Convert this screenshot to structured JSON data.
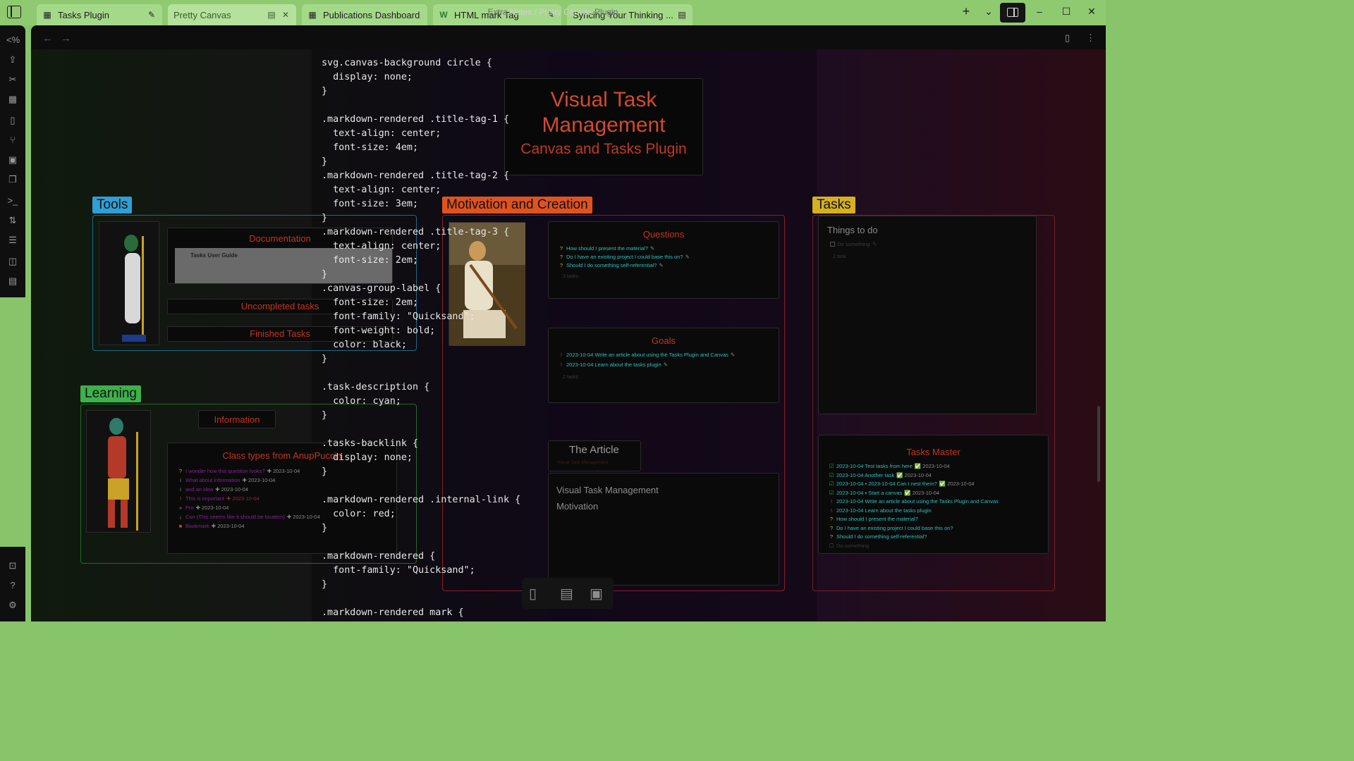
{
  "tabs": [
    {
      "label": "Tasks Plugin",
      "icon": "grid-icon",
      "right": "pin-icon"
    },
    {
      "label": "Pretty Canvas",
      "icon": "",
      "right": "close-icon"
    },
    {
      "label": "Publications Dashboard",
      "icon": "grid-icon",
      "right": ""
    },
    {
      "label": "HTML mark Tag",
      "icon": "w-icon",
      "right": "pin-icon"
    },
    {
      "label": "Syncing Your Thinking ...",
      "icon": "",
      "right": "clipboard-icon"
    }
  ],
  "breadcrumb": {
    "faded": "Extra",
    "path": "Notes / Pretty Canvas",
    "faded_right": "Plugin"
  },
  "code_lines": [
    "svg.canvas-background circle {",
    "  display: none;",
    "}",
    "",
    ".markdown-rendered .title-tag-1 {",
    "  text-align: center;",
    "  font-size: 4em;",
    "}",
    ".markdown-rendered .title-tag-2 {",
    "  text-align: center;",
    "  font-size: 3em;",
    "}",
    ".markdown-rendered .title-tag-3 {",
    "  text-align: center;",
    "  font-size: 2em;",
    "}",
    ".canvas-group-label {",
    "  font-size: 2em;",
    "  font-family: \"Quicksand\";",
    "  font-weight: bold;",
    "  color: black;",
    "}",
    "",
    ".task-description {",
    "  color: cyan;",
    "}",
    "",
    ".tasks-backlink {",
    "  display: none;",
    "}",
    "",
    ".markdown-rendered .internal-link {",
    "  color: red;",
    "}",
    "",
    ".markdown-rendered {",
    "  font-family: \"Quicksand\";",
    "}",
    "",
    ".markdown-rendered mark {"
  ],
  "title_card": {
    "line1": "Visual Task",
    "line2": "Management",
    "subtitle": "Canvas and Tasks Plugin"
  },
  "groups": {
    "tools": {
      "label": "Tools",
      "color": "#2fa0d6"
    },
    "learning": {
      "label": "Learning",
      "color": "#3bb24a"
    },
    "motivation": {
      "label": "Motivation and Creation",
      "color": "#e0531e"
    },
    "tasks": {
      "label": "Tasks",
      "color": "#d6b01e"
    }
  },
  "tools": {
    "documentation": "Documentation",
    "embed_title": "Tasks User Guide",
    "uncompleted": "Uncompleted tasks",
    "finished": "Finished Tasks"
  },
  "learning": {
    "information": "Information",
    "class_title": "Class types from AnupPuccin",
    "items": [
      {
        "text": "I wonder how this question looks?",
        "date": "2023-10-04",
        "mark": "?"
      },
      {
        "text": "What about information",
        "date": "2023-10-04",
        "mark": "i"
      },
      {
        "text": "and an idea",
        "date": "2023-10-04",
        "mark": "i"
      },
      {
        "text": "This is important",
        "date": "2023-10-04",
        "mark": "!"
      },
      {
        "text": "Pro",
        "date": "2023-10-04",
        "mark": "»"
      },
      {
        "text": "Con (This seems like it should be location)",
        "date": "2023-10-04",
        "mark": "↓"
      },
      {
        "text": "Bookmark",
        "date": "2023-10-04",
        "mark": "■"
      }
    ]
  },
  "questions": {
    "title": "Questions",
    "items": [
      "How should I present the material?",
      "Do I have an existing project I could base this on?",
      "Should I do something self-referential?"
    ],
    "count": "3 tasks"
  },
  "goals": {
    "title": "Goals",
    "items": [
      "2023-10-04 Write an article about using the Tasks Plugin and Canvas",
      "2023-10-04 Learn about the tasks plugin"
    ],
    "count": "2 tasks"
  },
  "article": {
    "title": "The Article",
    "link": "Visual Task Management",
    "body1": "Visual Task Management",
    "body2": "Motivation"
  },
  "things": {
    "title": "Things to do",
    "item": "Do something",
    "count": "1 task"
  },
  "tasks_master": {
    "title": "Tasks Master",
    "items": [
      {
        "text": "2023-10-04 Test tasks from here",
        "done": "2023-10-04",
        "mark": "done"
      },
      {
        "text": "2023-10-04 Another task",
        "done": "2023-10-04",
        "mark": "done"
      },
      {
        "text": "2023-10-04 ▪ 2023-10-04 Can I nest them?",
        "done": "2023-10-04",
        "mark": "done"
      },
      {
        "text": "2023-10-04 ▪ Start a canvas",
        "done": "2023-10-04",
        "mark": "done"
      },
      {
        "text": "2023-10-04 Write an article about using the Tasks Plugin and Canvas",
        "done": "",
        "mark": "!"
      },
      {
        "text": "2023-10-04 Learn about the tasks plugin",
        "done": "",
        "mark": "!"
      },
      {
        "text": "How should I present the material?",
        "done": "",
        "mark": "?"
      },
      {
        "text": "Do I have an existing project I could base this on?",
        "done": "",
        "mark": "?"
      },
      {
        "text": "Should I do something self-referential?",
        "done": "",
        "mark": "?"
      },
      {
        "text": "Do something",
        "done": "",
        "mark": "box"
      }
    ]
  }
}
